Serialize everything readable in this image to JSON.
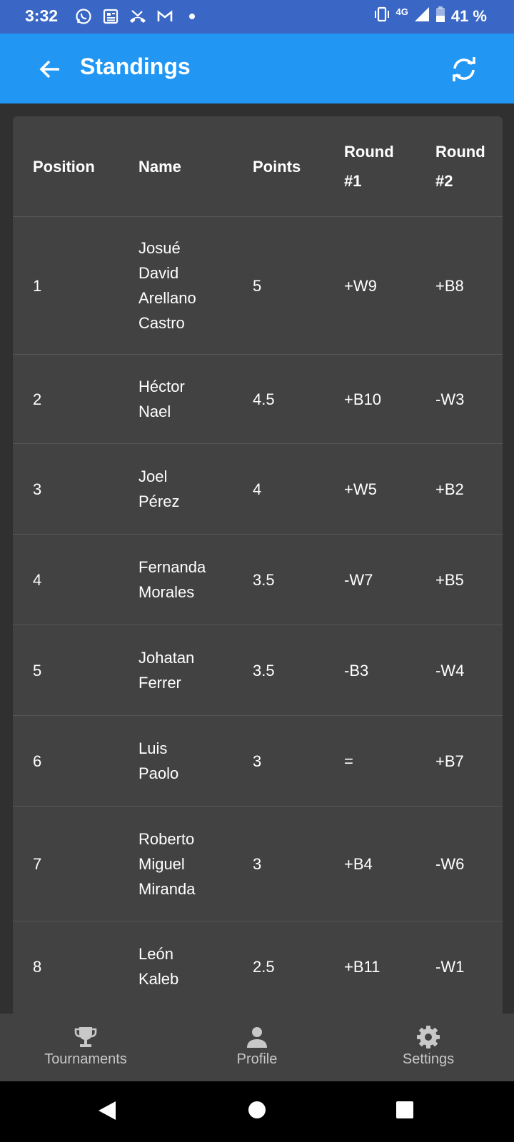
{
  "status": {
    "time": "3:32",
    "network": "4G",
    "battery": "41 %",
    "icons": [
      "whatsapp-icon",
      "news-icon",
      "missed-call-icon",
      "gmail-icon",
      "dot-icon"
    ]
  },
  "appbar": {
    "title": "Standings"
  },
  "table": {
    "headers": {
      "position": "Position",
      "name": "Name",
      "points": "Points",
      "round1_line1": "Round",
      "round1_line2": "#1",
      "round2_line1": "Round",
      "round2_line2": "#2"
    },
    "rows": [
      {
        "position": "1",
        "name": [
          "Josué",
          "David",
          "Arellano",
          "Castro"
        ],
        "points": "5",
        "round1": "+W9",
        "round2": "+B8"
      },
      {
        "position": "2",
        "name": [
          "Héctor",
          "Nael"
        ],
        "points": "4.5",
        "round1": "+B10",
        "round2": "-W3"
      },
      {
        "position": "3",
        "name": [
          "Joel",
          "Pérez"
        ],
        "points": "4",
        "round1": "+W5",
        "round2": "+B2"
      },
      {
        "position": "4",
        "name": [
          "Fernanda",
          "Morales"
        ],
        "points": "3.5",
        "round1": "-W7",
        "round2": "+B5"
      },
      {
        "position": "5",
        "name": [
          "Johatan",
          "Ferrer"
        ],
        "points": "3.5",
        "round1": "-B3",
        "round2": "-W4"
      },
      {
        "position": "6",
        "name": [
          "Luis",
          "Paolo"
        ],
        "points": "3",
        "round1": "=",
        "round2": "+B7"
      },
      {
        "position": "7",
        "name": [
          "Roberto",
          "Miguel",
          "Miranda"
        ],
        "points": "3",
        "round1": "+B4",
        "round2": "-W6"
      },
      {
        "position": "8",
        "name": [
          "León",
          "Kaleb"
        ],
        "points": "2.5",
        "round1": "+B11",
        "round2": "-W1"
      }
    ]
  },
  "nav": {
    "tournaments": "Tournaments",
    "profile": "Profile",
    "settings": "Settings"
  },
  "colors": {
    "status_bar": "#3a67c6",
    "app_bar": "#2196f3",
    "background": "#303030",
    "card": "#424242"
  }
}
